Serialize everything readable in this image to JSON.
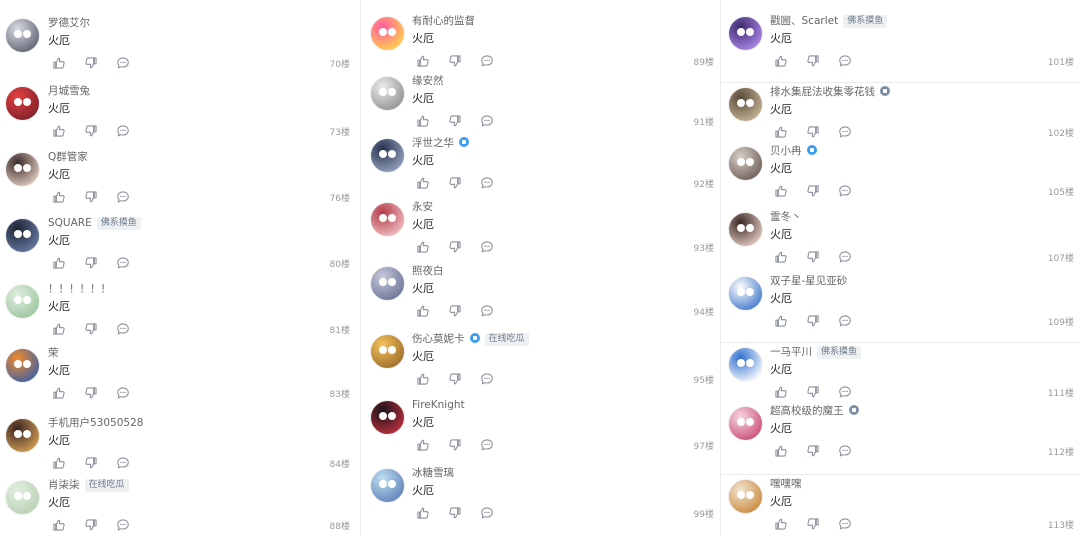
{
  "icons": {
    "like": "thumbs-up-icon",
    "dislike": "thumbs-down-icon",
    "reply": "reply-bubble-icon"
  },
  "columns": [
    {
      "comments": [
        {
          "user": "罗德艾尔",
          "text": "火厄",
          "floor": "70楼",
          "badge": "",
          "verified": "",
          "avatar": {
            "c1": "#d9dbe3",
            "c2": "#5b5f6e"
          }
        },
        {
          "user": "月城雪兔",
          "text": "火厄",
          "floor": "73楼",
          "badge": "",
          "verified": "",
          "avatar": {
            "c1": "#e54040",
            "c2": "#7a1f2a"
          }
        },
        {
          "user": "Q群管家",
          "text": "火厄",
          "floor": "76楼",
          "badge": "",
          "verified": "",
          "avatar": {
            "c1": "#3b2a2a",
            "c2": "#e8d2c4"
          }
        },
        {
          "user": "SQUARE",
          "text": "火厄",
          "floor": "80楼",
          "badge": "佛系摸鱼",
          "verified": "",
          "avatar": {
            "c1": "#1d2433",
            "c2": "#6a7da8"
          }
        },
        {
          "user": "！！！！！！",
          "text": "火厄",
          "floor": "81楼",
          "badge": "",
          "verified": "",
          "avatar": {
            "c1": "#dfeee0",
            "c2": "#9ac59b"
          }
        },
        {
          "user": "荣",
          "text": "火厄",
          "floor": "83楼",
          "badge": "",
          "verified": "",
          "avatar": {
            "c1": "#f08a2c",
            "c2": "#3a5fa8"
          }
        },
        {
          "user": "手机用户53050528",
          "text": "火厄",
          "floor": "84楼",
          "badge": "",
          "verified": "",
          "avatar": {
            "c1": "#3a2323",
            "c2": "#d8a354"
          }
        },
        {
          "user": "肖柒柒",
          "text": "火厄",
          "floor": "88楼",
          "badge": "在线吃瓜",
          "verified": "",
          "avatar": {
            "c1": "#e4efe2",
            "c2": "#b7d1b2"
          }
        }
      ]
    },
    {
      "comments": [
        {
          "user": "有耐心的监督",
          "text": "火厄",
          "floor": "89楼",
          "badge": "",
          "verified": "",
          "avatar": {
            "c1": "#ff5aa0",
            "c2": "#ffd84a"
          }
        },
        {
          "user": "缘安然",
          "text": "火厄",
          "floor": "91楼",
          "badge": "",
          "verified": "",
          "avatar": {
            "c1": "#ececec",
            "c2": "#8e8e8e"
          }
        },
        {
          "user": "浮世之华",
          "text": "火厄",
          "floor": "92楼",
          "badge": "",
          "verified": "blue",
          "avatar": {
            "c1": "#26334d",
            "c2": "#9aa7c4"
          }
        },
        {
          "user": "永安",
          "text": "火厄",
          "floor": "93楼",
          "badge": "",
          "verified": "",
          "avatar": {
            "c1": "#b23a48",
            "c2": "#f3c3c7"
          }
        },
        {
          "user": "照夜白",
          "text": "火厄",
          "floor": "94楼",
          "badge": "",
          "verified": "",
          "avatar": {
            "c1": "#c4c9dc",
            "c2": "#6b7193"
          }
        },
        {
          "user": "伤心莫妮卡",
          "text": "火厄",
          "floor": "95楼",
          "badge": "在线吃瓜",
          "verified": "blue",
          "avatar": {
            "c1": "#f4c15a",
            "c2": "#9b6b2a"
          }
        },
        {
          "user": "FireKnight",
          "text": "火厄",
          "floor": "97楼",
          "badge": "",
          "verified": "",
          "avatar": {
            "c1": "#1a1418",
            "c2": "#c03040"
          }
        },
        {
          "user": "冰糖雪璃",
          "text": "火厄",
          "floor": "99楼",
          "badge": "",
          "verified": "",
          "avatar": {
            "c1": "#bfe0f2",
            "c2": "#5b7fb5"
          }
        }
      ]
    },
    {
      "comments": [
        {
          "user": "戳圌、Scarlet",
          "text": "火厄",
          "floor": "101楼",
          "badge": "佛系摸鱼",
          "verified": "",
          "avatar": {
            "c1": "#3b2a6b",
            "c2": "#b08cf0"
          }
        },
        {
          "user": "排水集屁法收集零花钱",
          "text": "火厄",
          "floor": "102楼",
          "badge": "",
          "verified": "gray",
          "avatar": {
            "c1": "#5a4a3a",
            "c2": "#cbb89a"
          }
        },
        {
          "user": "贝小冉",
          "text": "火厄",
          "floor": "105楼",
          "badge": "",
          "verified": "blue",
          "avatar": {
            "c1": "#d8cfc8",
            "c2": "#6a5a54"
          }
        },
        {
          "user": "霊冬丶",
          "text": "火厄",
          "floor": "107楼",
          "badge": "",
          "verified": "",
          "avatar": {
            "c1": "#3a2424",
            "c2": "#e9d3c8"
          }
        },
        {
          "user": "双子星-星见亚砂",
          "text": "火厄",
          "floor": "109楼",
          "badge": "",
          "verified": "",
          "avatar": {
            "c1": "#ffffff",
            "c2": "#3c74c8"
          }
        },
        {
          "user": "一马平川",
          "text": "火厄",
          "floor": "111楼",
          "badge": "佛系摸鱼",
          "verified": "",
          "avatar": {
            "c1": "#2f6fd0",
            "c2": "#ffffff"
          }
        },
        {
          "user": "超高校级的魔王",
          "text": "火厄",
          "floor": "112楼",
          "badge": "",
          "verified": "gray",
          "avatar": {
            "c1": "#f6d6e4",
            "c2": "#c84a74"
          }
        },
        {
          "user": "嘿嘿嘿",
          "text": "火厄",
          "floor": "113楼",
          "badge": "",
          "verified": "",
          "avatar": {
            "c1": "#f1e4d0",
            "c2": "#c9873a"
          }
        }
      ]
    }
  ]
}
